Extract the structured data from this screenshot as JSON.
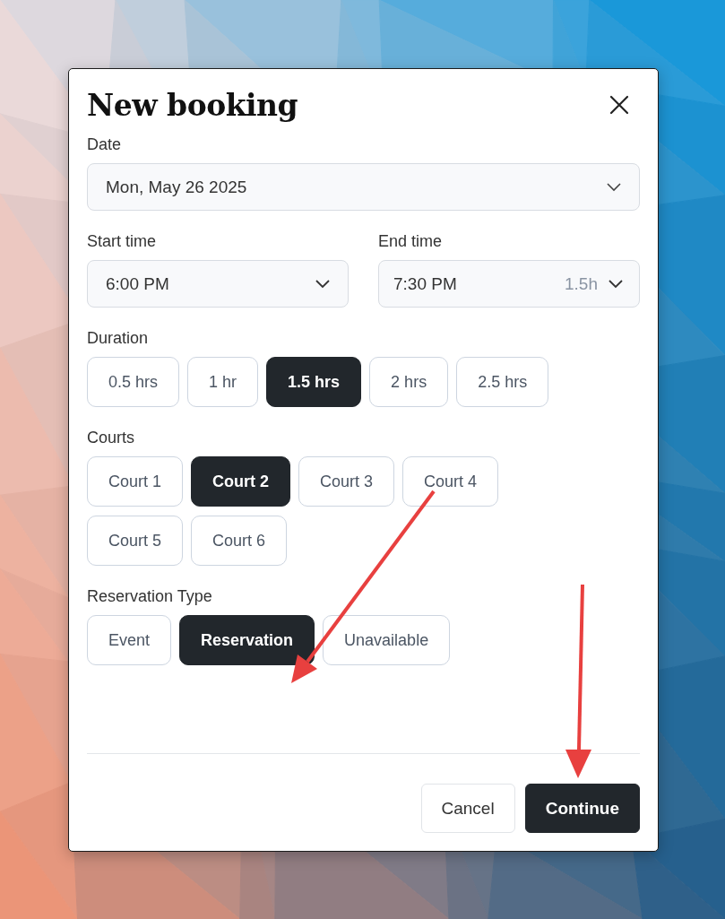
{
  "dialog": {
    "title": "New booking",
    "date": {
      "label": "Date",
      "value": "Mon, May 26 2025"
    },
    "start_time": {
      "label": "Start time",
      "value": "6:00 PM"
    },
    "end_time": {
      "label": "End time",
      "value": "7:30 PM",
      "hint": "1.5h"
    },
    "groups": [
      {
        "label": "Duration",
        "options": [
          {
            "label": "0.5 hrs",
            "selected": false
          },
          {
            "label": "1 hr",
            "selected": false
          },
          {
            "label": "1.5 hrs",
            "selected": true
          },
          {
            "label": "2 hrs",
            "selected": false
          },
          {
            "label": "2.5 hrs",
            "selected": false
          }
        ]
      },
      {
        "label": "Courts",
        "options": [
          {
            "label": "Court 1",
            "selected": false
          },
          {
            "label": "Court 2",
            "selected": true
          },
          {
            "label": "Court 3",
            "selected": false
          },
          {
            "label": "Court 4",
            "selected": false
          },
          {
            "label": "Court 5",
            "selected": false
          },
          {
            "label": "Court 6",
            "selected": false
          }
        ]
      },
      {
        "label": "Reservation Type",
        "options": [
          {
            "label": "Event",
            "selected": false
          },
          {
            "label": "Reservation",
            "selected": true
          },
          {
            "label": "Unavailable",
            "selected": false
          }
        ]
      }
    ],
    "buttons": [
      {
        "label": "Cancel",
        "kind": "secondary"
      },
      {
        "label": "Continue",
        "kind": "primary"
      }
    ]
  },
  "annotations": [
    {
      "kind": "arrow"
    },
    {
      "kind": "arrow"
    }
  ]
}
